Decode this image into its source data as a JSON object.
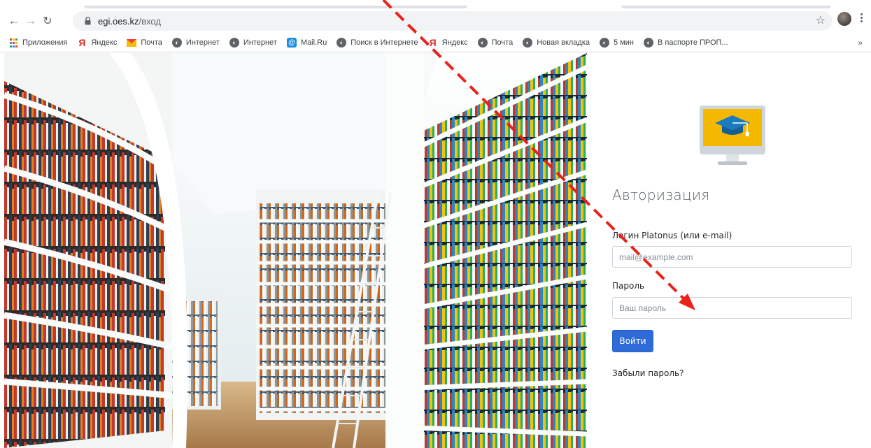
{
  "browser": {
    "url_host": "egi.oes.kz",
    "url_path": "/вход",
    "bookmarks": [
      {
        "label": "Приложения",
        "icon": "apps-icon"
      },
      {
        "label": "Яндекс",
        "icon": "yandex-icon"
      },
      {
        "label": "Почта",
        "icon": "gmail-icon"
      },
      {
        "label": "Интернет",
        "icon": "globe-icon"
      },
      {
        "label": "Интернет",
        "icon": "globe-icon"
      },
      {
        "label": "Mail.Ru",
        "icon": "mailru-icon"
      },
      {
        "label": "Поиск в Интернете",
        "icon": "globe-icon"
      },
      {
        "label": "Яндекс",
        "icon": "yandex-icon"
      },
      {
        "label": "Почта",
        "icon": "globe-icon"
      },
      {
        "label": "Новая вкладка",
        "icon": "globe-icon"
      },
      {
        "label": "5 мин",
        "icon": "globe-icon"
      },
      {
        "label": "В паспорте ПРОП...",
        "icon": "globe-icon"
      }
    ],
    "bookmarks_overflow": "»"
  },
  "auth": {
    "title": "Авторизация",
    "login_label": "Логин Platonus (или e-mail)",
    "login_placeholder": "mail@example.com",
    "password_label": "Пароль",
    "password_placeholder": "Ваш пароль",
    "submit_label": "Войти",
    "forgot_label": "Забыли пароль?"
  },
  "colors": {
    "primary": "#2e6bd8",
    "annotation_arrow": "#e8231a",
    "logo_screen": "#f5b800",
    "logo_cap": "#1a7bbf"
  }
}
